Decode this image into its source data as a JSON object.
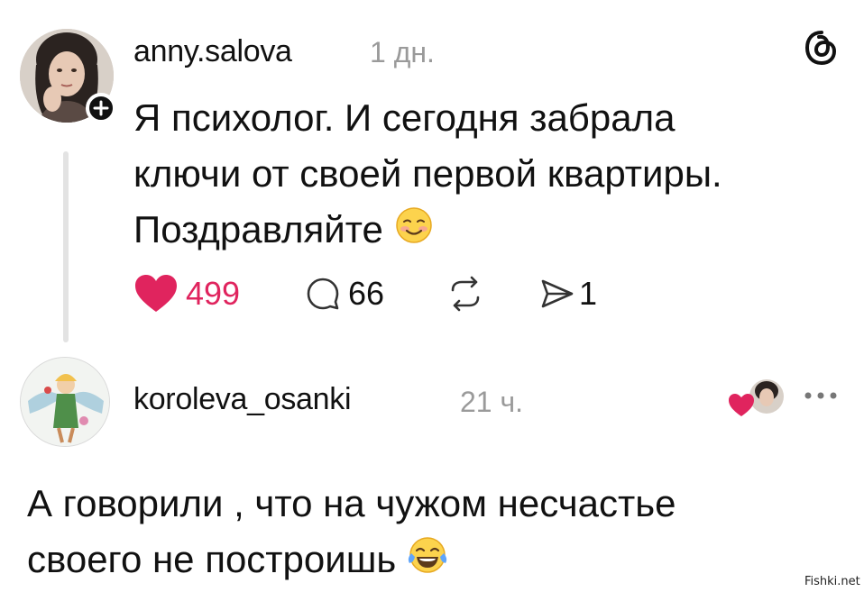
{
  "post1": {
    "username": "anny.salova",
    "time": "1 дн.",
    "text_lines": [
      "Я психолог. И сегодня забрала",
      "ключи от своей первой квартиры.",
      "Поздравляйте"
    ],
    "emoji": "smiling-face-emoji",
    "likes": "499",
    "comments": "66",
    "shares": "1",
    "like_color": "#e0245e"
  },
  "post2": {
    "username": "koroleva_osanki",
    "time": "21 ч.",
    "text_lines": [
      "А говорили , что на чужом несчастье",
      "своего не построишь"
    ],
    "emoji": "tears-of-joy-emoji"
  },
  "watermark": "Fishki.net"
}
